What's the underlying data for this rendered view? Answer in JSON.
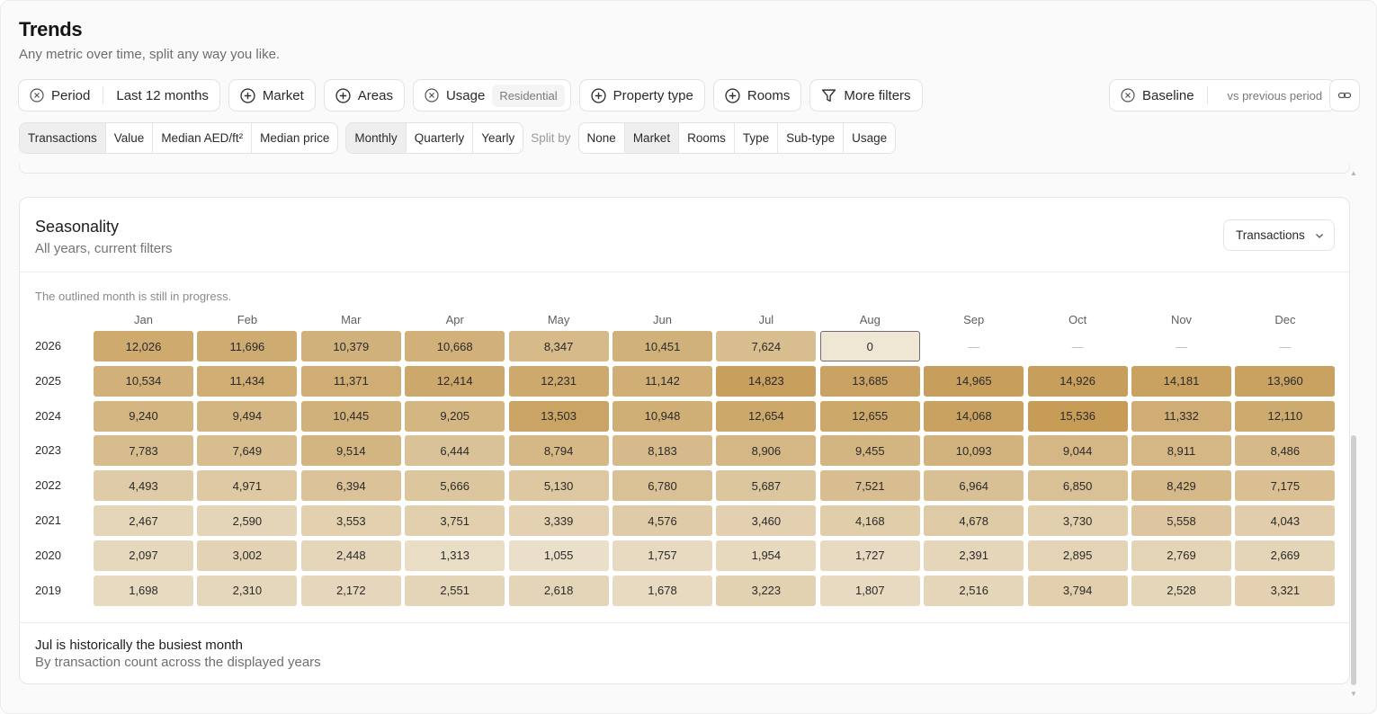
{
  "header": {
    "title": "Trends",
    "subtitle": "Any metric over time, split any way you like."
  },
  "filters": {
    "period_label": "Period",
    "period_value": "Last 12 months",
    "market_label": "Market",
    "areas_label": "Areas",
    "usage_label": "Usage",
    "usage_value": "Residential",
    "property_type_label": "Property type",
    "rooms_label": "Rooms",
    "more_filters_label": "More filters",
    "baseline_label": "Baseline",
    "baseline_value": "vs previous period"
  },
  "metrics": {
    "options": [
      "Transactions",
      "Value",
      "Median AED/ft²",
      "Median price"
    ],
    "selected": "Transactions"
  },
  "granularity": {
    "options": [
      "Monthly",
      "Quarterly",
      "Yearly"
    ],
    "selected": "Monthly"
  },
  "split": {
    "label": "Split by",
    "options": [
      "None",
      "Market",
      "Rooms",
      "Type",
      "Sub-type",
      "Usage"
    ],
    "selected": "Market"
  },
  "card": {
    "title": "Seasonality",
    "subtitle": "All years, current filters",
    "metric_select": "Transactions",
    "note": "The outlined month is still in progress.",
    "insight_title": "Jul is historically the busiest month",
    "insight_sub": "By transaction count across the displayed years"
  },
  "colors": {
    "low": "#e8dcc4",
    "high": "#c9a25f",
    "current_outline": "#6d6d6d"
  },
  "chart_data": {
    "type": "heatmap",
    "title": "Seasonality",
    "subtitle": "All years, current filters",
    "x": [
      "Jan",
      "Feb",
      "Mar",
      "Apr",
      "May",
      "Jun",
      "Jul",
      "Aug",
      "Sep",
      "Oct",
      "Nov",
      "Dec"
    ],
    "y": [
      "2026",
      "2025",
      "2024",
      "2023",
      "2022",
      "2021",
      "2020",
      "2019"
    ],
    "values": [
      [
        12026,
        11696,
        10379,
        10668,
        8347,
        10451,
        7624,
        0,
        null,
        null,
        null,
        null
      ],
      [
        10534,
        11434,
        11371,
        12414,
        12231,
        11142,
        14823,
        13685,
        14965,
        14926,
        14181,
        13960
      ],
      [
        9240,
        9494,
        10445,
        9205,
        13503,
        10948,
        12654,
        12655,
        14068,
        15536,
        11332,
        12110
      ],
      [
        7783,
        7649,
        9514,
        6444,
        8794,
        8183,
        8906,
        9455,
        10093,
        9044,
        8911,
        8486
      ],
      [
        4493,
        4971,
        6394,
        5666,
        5130,
        6780,
        5687,
        7521,
        6964,
        6850,
        8429,
        7175
      ],
      [
        2467,
        2590,
        3553,
        3751,
        3339,
        4576,
        3460,
        4168,
        4678,
        3730,
        5558,
        4043
      ],
      [
        2097,
        3002,
        2448,
        1313,
        1055,
        1757,
        1954,
        1727,
        2391,
        2895,
        2769,
        2669
      ],
      [
        1698,
        2310,
        2172,
        2551,
        2618,
        1678,
        3223,
        1807,
        2516,
        3794,
        2528,
        3321
      ]
    ],
    "empty_symbol": "—",
    "in_progress": {
      "year": "2026",
      "month": "Aug"
    }
  }
}
